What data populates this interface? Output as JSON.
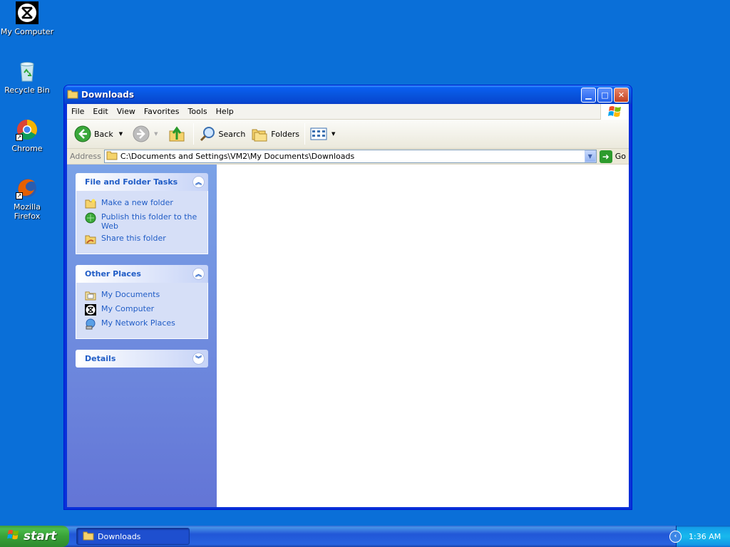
{
  "desktop": {
    "icons": [
      {
        "label": "My Computer"
      },
      {
        "label": "Recycle Bin"
      },
      {
        "label": "Chrome"
      },
      {
        "label": "Mozilla Firefox"
      }
    ]
  },
  "window": {
    "title": "Downloads",
    "menu": [
      "File",
      "Edit",
      "View",
      "Favorites",
      "Tools",
      "Help"
    ],
    "toolbar": {
      "back_label": "Back",
      "search_label": "Search",
      "folders_label": "Folders"
    },
    "address": {
      "label": "Address",
      "value": "C:\\Documents and Settings\\VM2\\My Documents\\Downloads",
      "go_label": "Go"
    },
    "taskpane": {
      "file_tasks": {
        "title": "File and Folder Tasks",
        "items": [
          "Make a new folder",
          "Publish this folder to the Web",
          "Share this folder"
        ]
      },
      "other_places": {
        "title": "Other Places",
        "items": [
          "My Documents",
          "My Computer",
          "My Network Places"
        ]
      },
      "details": {
        "title": "Details"
      }
    }
  },
  "taskbar": {
    "start_label": "start",
    "items": [
      {
        "label": "Downloads"
      }
    ],
    "clock": "1:36 AM"
  },
  "colors": {
    "desktop": "#0a6fd8",
    "taskpane_link": "#215dc6"
  }
}
